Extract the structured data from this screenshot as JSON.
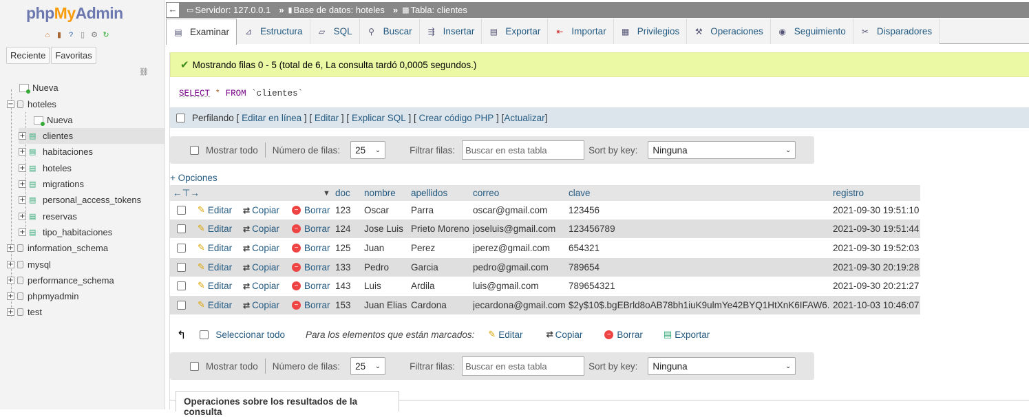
{
  "sidebar": {
    "logo": {
      "php": "php",
      "my": "My",
      "admin": "Admin"
    },
    "quick_icons": [
      "home-icon",
      "exit-icon",
      "help-icon",
      "docs-icon",
      "settings-icon",
      "reload-icon"
    ],
    "tabs": [
      "Reciente",
      "Favoritas"
    ],
    "tree": {
      "nueva_root": "Nueva",
      "hoteles_db": "hoteles",
      "nueva_table": "Nueva",
      "tables": [
        "clientes",
        "habitaciones",
        "hoteles",
        "migrations",
        "personal_access_tokens",
        "reservas",
        "tipo_habitaciones"
      ],
      "other_dbs": [
        "information_schema",
        "mysql",
        "performance_schema",
        "phpmyadmin",
        "test"
      ]
    }
  },
  "breadcrumb": {
    "server": "Servidor: 127.0.0.1",
    "database": "Base de datos: hoteles",
    "table": "Tabla: clientes",
    "separator": "»"
  },
  "tabs": [
    "Examinar",
    "Estructura",
    "SQL",
    "Buscar",
    "Insertar",
    "Exportar",
    "Importar",
    "Privilegios",
    "Operaciones",
    "Seguimiento",
    "Disparadores"
  ],
  "success_message": "Mostrando filas 0 - 5 (total de 6, La consulta tardó 0,0005 segundos.)",
  "sql": {
    "select": "SELECT",
    "star": "*",
    "from": "FROM",
    "table": "`clientes`"
  },
  "profile": {
    "label": "Perfilando",
    "links": [
      "Editar en línea",
      "Editar",
      "Explicar SQL",
      "Crear código PHP",
      "Actualizar"
    ]
  },
  "nav": {
    "show_all": "Mostrar todo",
    "rows_label": "Número de filas:",
    "rows_value": "25",
    "filter_label": "Filtrar filas:",
    "filter_placeholder": "Buscar en esta tabla",
    "sort_label": "Sort by key:",
    "sort_value": "Ninguna"
  },
  "options_link": "+ Opciones",
  "table": {
    "columns": [
      "doc",
      "nombre",
      "apellidos",
      "correo",
      "clave",
      "registro"
    ],
    "actions": {
      "edit": "Editar",
      "copy": "Copiar",
      "delete": "Borrar"
    },
    "rows": [
      [
        "123",
        "Oscar",
        "Parra",
        "oscar@gmail.com",
        "123456",
        "2021-09-30 19:51:10"
      ],
      [
        "124",
        "Jose Luis",
        "Prieto Moreno",
        "joseluis@gmail.com",
        "123456789",
        "2021-09-30 19:51:44"
      ],
      [
        "125",
        "Juan",
        "Perez",
        "jperez@gmail.com",
        "654321",
        "2021-09-30 19:52:03"
      ],
      [
        "133",
        "Pedro",
        "Garcia",
        "pedro@gmail.com",
        "789654",
        "2021-09-30 20:19:28"
      ],
      [
        "143",
        "Luis",
        "Ardila",
        "luis@gmail.com",
        "789654321",
        "2021-09-30 20:21:27"
      ],
      [
        "153",
        "Juan Elias",
        "Cardona",
        "jecardona@gmail.com",
        "$2y$10$.bgEBrld8oAB78bh1iuK9ulmYe42BYQ1HtXnK6IFAW6...",
        "2021-10-03 10:46:07"
      ]
    ]
  },
  "bulk": {
    "select_all": "Seleccionar todo",
    "with_selected": "Para los elementos que están marcados:",
    "edit": "Editar",
    "copy": "Copiar",
    "delete": "Borrar",
    "export": "Exportar"
  },
  "query_ops": "Operaciones sobre los resultados de la consulta"
}
